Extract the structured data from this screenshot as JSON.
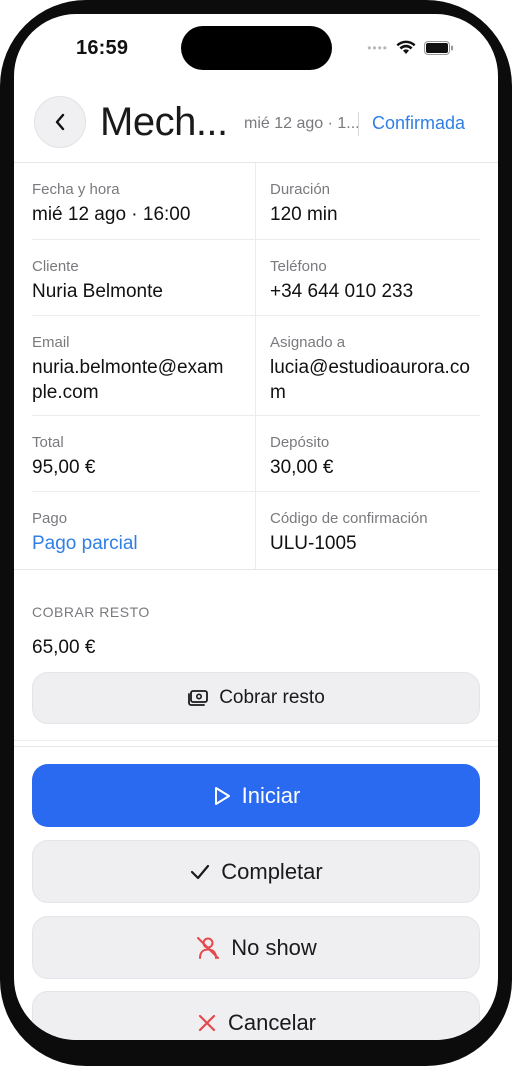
{
  "status_bar": {
    "time": "16:59"
  },
  "header": {
    "title": "Mech...",
    "subtitle": "mié 12 ago · 1...",
    "status": "Confirmada",
    "status_color": "#2f7fe6"
  },
  "details": [
    {
      "left": {
        "label": "Fecha y hora",
        "value": "mié 12 ago · 16:00"
      },
      "right": {
        "label": "Duración",
        "value": "120 min"
      }
    },
    {
      "left": {
        "label": "Cliente",
        "value": "Nuria Belmonte"
      },
      "right": {
        "label": "Teléfono",
        "value": "+34 644 010 233"
      }
    },
    {
      "left": {
        "label": "Email",
        "value": "nuria.belmonte@example.com"
      },
      "right": {
        "label": "Asignado a",
        "value": "lucia@estudioaurora.com"
      }
    },
    {
      "left": {
        "label": "Total",
        "value": "95,00 €"
      },
      "right": {
        "label": "Depósito",
        "value": "30,00 €"
      }
    },
    {
      "left": {
        "label": "Pago",
        "value": "Pago parcial"
      },
      "right": {
        "label": "Código de confirmación",
        "value": "ULU-1005"
      }
    }
  ],
  "collect": {
    "section_label": "COBRAR RESTO",
    "amount": "65,00 €",
    "button_label": "Cobrar resto",
    "button_icon": "cash-icon"
  },
  "actions": {
    "start": {
      "label": "Iniciar",
      "icon": "play-icon",
      "color": "#2a6af0"
    },
    "complete": {
      "label": "Completar",
      "icon": "checkmark-icon"
    },
    "no_show": {
      "label": "No show",
      "icon": "user-off-icon",
      "icon_color": "#e5484d"
    },
    "cancel": {
      "label": "Cancelar",
      "icon": "close-icon",
      "icon_color": "#e5484d"
    }
  }
}
